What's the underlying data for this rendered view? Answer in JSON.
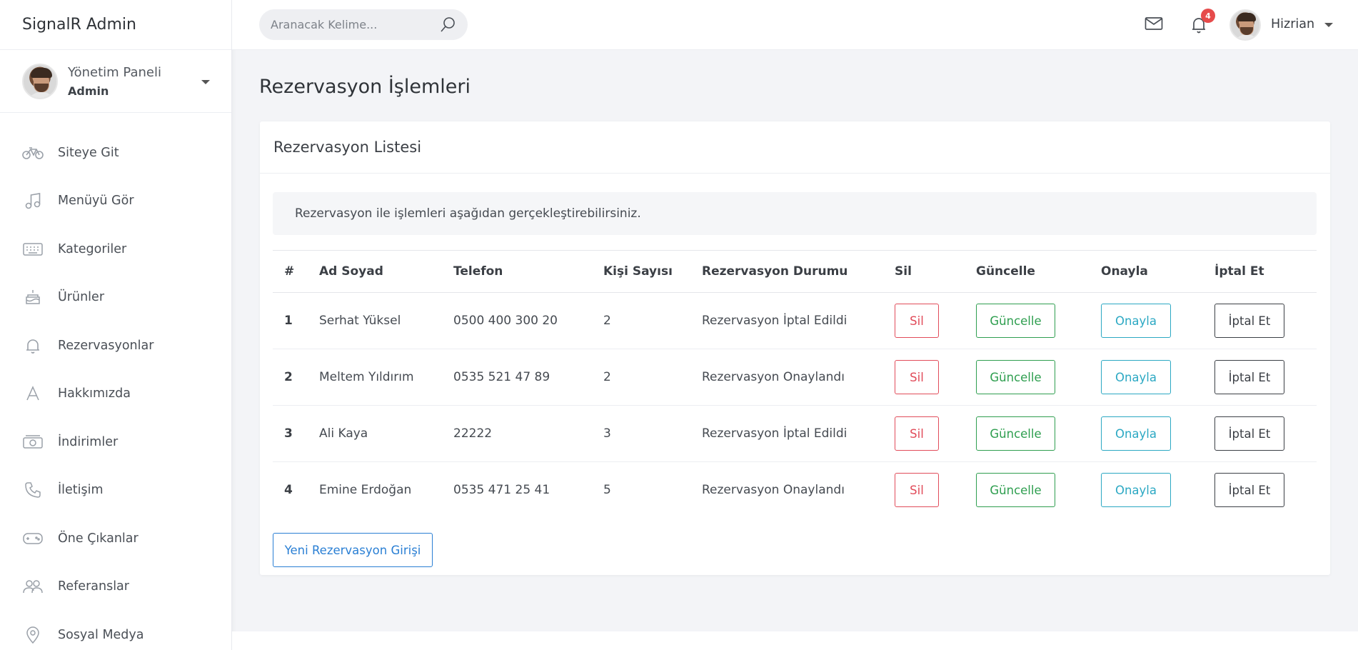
{
  "app": {
    "brand": "SignalR Admin"
  },
  "profile": {
    "name": "Yönetim Paneli",
    "role": "Admin"
  },
  "sidebar": {
    "items": [
      {
        "label": "Siteye Git",
        "icon": "bicycle-icon"
      },
      {
        "label": "Menüyü Gör",
        "icon": "music-note-icon"
      },
      {
        "label": "Kategoriler",
        "icon": "keyboard-icon"
      },
      {
        "label": "Ürünler",
        "icon": "cake-icon"
      },
      {
        "label": "Rezervasyonlar",
        "icon": "bell-icon"
      },
      {
        "label": "Hakkımızda",
        "icon": "letter-a-icon"
      },
      {
        "label": "İndirimler",
        "icon": "money-icon"
      },
      {
        "label": "İletişim",
        "icon": "phone-icon"
      },
      {
        "label": "Öne Çıkanlar",
        "icon": "gamepad-icon"
      },
      {
        "label": "Referanslar",
        "icon": "users-icon"
      },
      {
        "label": "Sosyal Medya",
        "icon": "map-pin-icon"
      }
    ]
  },
  "topbar": {
    "search_placeholder": "Aranacak Kelime...",
    "notification_count": "4",
    "user_name": "Hizrian"
  },
  "page": {
    "title": "Rezervasyon İşlemleri"
  },
  "card": {
    "title": "Rezervasyon Listesi",
    "info": "Rezervasyon ile işlemleri aşağıdan gerçekleştirebilirsiniz."
  },
  "table": {
    "headers": [
      "#",
      "Ad Soyad",
      "Telefon",
      "Kişi Sayısı",
      "Rezervasyon Durumu",
      "Sil",
      "Güncelle",
      "Onayla",
      "İptal Et"
    ],
    "rows": [
      {
        "id": "1",
        "name": "Serhat Yüksel",
        "phone": "0500 400 300 20",
        "count": "2",
        "status": "Rezervasyon İptal Edildi"
      },
      {
        "id": "2",
        "name": "Meltem Yıldırım",
        "phone": "0535 521 47 89",
        "count": "2",
        "status": "Rezervasyon Onaylandı"
      },
      {
        "id": "3",
        "name": "Ali Kaya",
        "phone": "22222",
        "count": "3",
        "status": "Rezervasyon İptal Edildi"
      },
      {
        "id": "4",
        "name": "Emine Erdoğan",
        "phone": "0535 471 25 41",
        "count": "5",
        "status": "Rezervasyon Onaylandı"
      }
    ],
    "actions": {
      "delete": "Sil",
      "update": "Güncelle",
      "approve": "Onayla",
      "cancel": "İptal Et"
    }
  },
  "buttons": {
    "new_reservation": "Yeni Rezervasyon Girişi"
  },
  "colors": {
    "danger": "#e14c5a",
    "success": "#2e9e4f",
    "info": "#2ba8c3",
    "dark": "#3b3f45",
    "primary": "#2a7fd4",
    "badge": "#e64b4b"
  }
}
